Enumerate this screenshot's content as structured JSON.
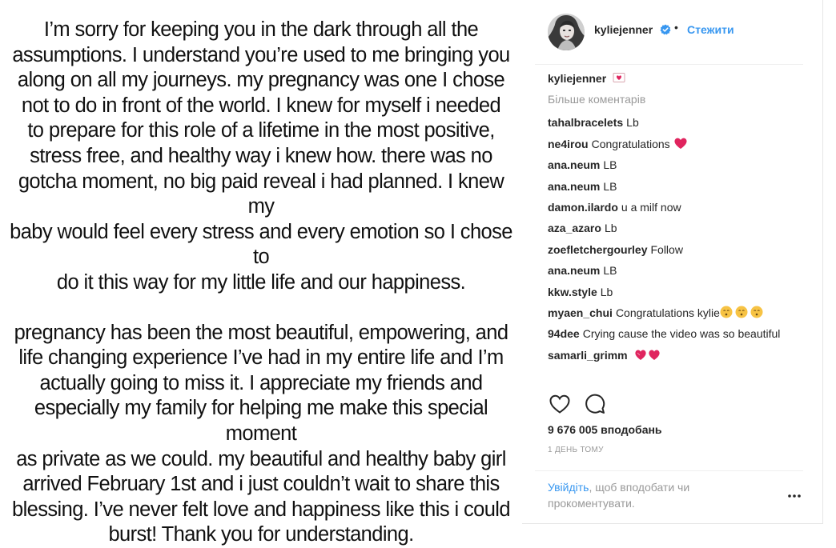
{
  "post_image": {
    "paragraph1": "I’m sorry for keeping you in the dark through all the\nassumptions. I understand you’re used to me bringing you\nalong on all my journeys. my pregnancy was one I chose\nnot to do in front of the world. I knew for myself i needed\nto prepare for this role of a lifetime in the most positive,\nstress free, and healthy way i knew how. there was no\ngotcha moment, no big paid reveal i had planned. I knew my\nbaby would feel every stress and every emotion so I chose to\ndo it this way for my little life and our happiness.",
    "paragraph2": "pregnancy has been the most beautiful, empowering, and\nlife changing experience I’ve had in my entire life and I’m\nactually going to miss it. I appreciate my friends and\nespecially my family for helping me make this special moment\nas private as we could. my beautiful and healthy baby girl\narrived February 1st and i just couldn’t wait to share this\nblessing. I’ve never felt love and happiness like this i could\nburst! Thank you for understanding."
  },
  "header": {
    "username": "kyliejenner",
    "separator": "•",
    "follow_label": "Стежити",
    "verified_icon": "verified-badge-icon"
  },
  "caption": {
    "username": "kyliejenner",
    "emoji_icon": "heart-letter-icon"
  },
  "more_comments_label": "Більше коментарів",
  "comments": [
    {
      "user": "tahalbracelets",
      "text": "Lb"
    },
    {
      "user": "ne4irou",
      "text": "Congratulations",
      "emoji": "red-heart-icon"
    },
    {
      "user": "ana.neum",
      "text": "LB"
    },
    {
      "user": "ana.neum",
      "text": "LB"
    },
    {
      "user": "damon.ilardo",
      "text": "u a milf now"
    },
    {
      "user": "aza_azaro",
      "text": "Lb"
    },
    {
      "user": "zoefletchergourley",
      "text": "Follow"
    },
    {
      "user": "ana.neum",
      "text": "LB"
    },
    {
      "user": "kkw.style",
      "text": "Lb"
    },
    {
      "user": "myaen_chui",
      "text": "Congratulations kylie",
      "emoji": "kissing-face-icon x3"
    },
    {
      "user": "94dee",
      "text": "Crying cause the video was so beautiful"
    },
    {
      "user": "samarli_grimm",
      "text": "",
      "emoji": "two-hearts-icon"
    }
  ],
  "likes_label": "9 676 005 вподобань",
  "time_label": "1 ДЕНЬ ТОМУ",
  "login": {
    "link_label": "Увійдіть",
    "rest_label": ", щоб вподобати чи прокоментувати."
  },
  "colors": {
    "accent": "#3897f0",
    "text": "#262626",
    "muted": "#999999",
    "heart": "#ed4956"
  }
}
